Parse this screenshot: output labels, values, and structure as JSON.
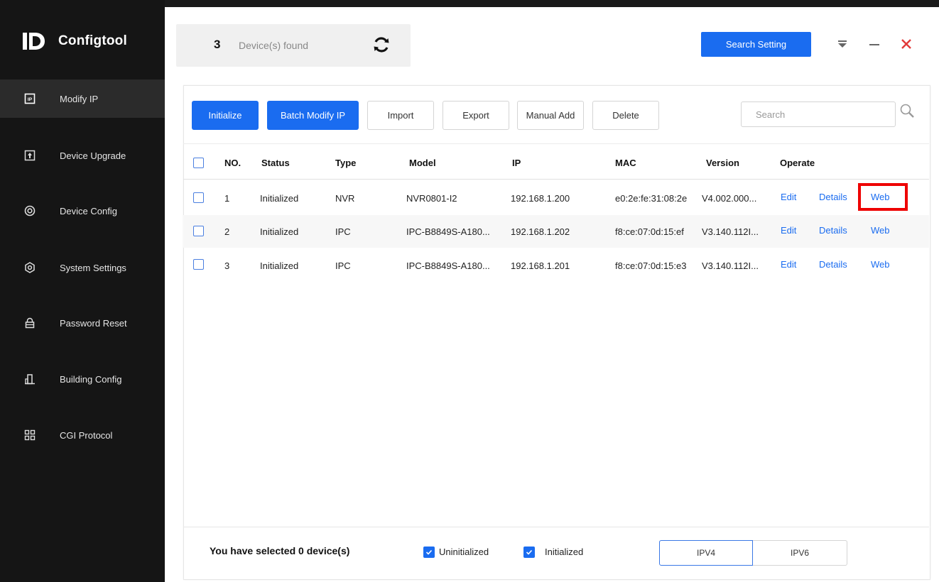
{
  "app": {
    "name": "Configtool"
  },
  "sidebar": {
    "items": [
      {
        "label": "Modify IP",
        "icon": "ip-icon",
        "active": true
      },
      {
        "label": "Device Upgrade",
        "icon": "upload-icon"
      },
      {
        "label": "Device Config",
        "icon": "target-icon"
      },
      {
        "label": "System Settings",
        "icon": "gear-hex-icon"
      },
      {
        "label": "Password Reset",
        "icon": "lock-icon"
      },
      {
        "label": "Building Config",
        "icon": "building-icon"
      },
      {
        "label": "CGI Protocol",
        "icon": "grid-icon"
      }
    ]
  },
  "header": {
    "found_count": "3",
    "found_label": "Device(s) found",
    "search_setting": "Search Setting"
  },
  "toolbar": {
    "initialize": "Initialize",
    "batch_modify_ip": "Batch Modify IP",
    "import": "Import",
    "export": "Export",
    "manual_add": "Manual Add",
    "delete": "Delete",
    "search_placeholder": "Search"
  },
  "table": {
    "columns": {
      "no": "NO.",
      "status": "Status",
      "type": "Type",
      "model": "Model",
      "ip": "IP",
      "mac": "MAC",
      "version": "Version",
      "operate": "Operate"
    },
    "rows": [
      {
        "no": "1",
        "status": "Initialized",
        "type": "NVR",
        "model": "NVR0801-I2",
        "ip": "192.168.1.200",
        "mac": "e0:2e:fe:31:08:2e",
        "version": "V4.002.000...",
        "edit": "Edit",
        "details": "Details",
        "web": "Web"
      },
      {
        "no": "2",
        "status": "Initialized",
        "type": "IPC",
        "model": "IPC-B8849S-A180...",
        "ip": "192.168.1.202",
        "mac": "f8:ce:07:0d:15:ef",
        "version": "V3.140.112I...",
        "edit": "Edit",
        "details": "Details",
        "web": "Web"
      },
      {
        "no": "3",
        "status": "Initialized",
        "type": "IPC",
        "model": "IPC-B8849S-A180...",
        "ip": "192.168.1.201",
        "mac": "f8:ce:07:0d:15:e3",
        "version": "V3.140.112I...",
        "edit": "Edit",
        "details": "Details",
        "web": "Web"
      }
    ]
  },
  "footer": {
    "selected_text": "You have selected 0  device(s)",
    "filter_uninitialized": "Uninitialized",
    "filter_initialized": "Initialized",
    "ipv4": "IPV4",
    "ipv6": "IPV6"
  },
  "colors": {
    "accent": "#1a6cf0",
    "sidebar": "#151515",
    "highlight": "#ee0000"
  }
}
